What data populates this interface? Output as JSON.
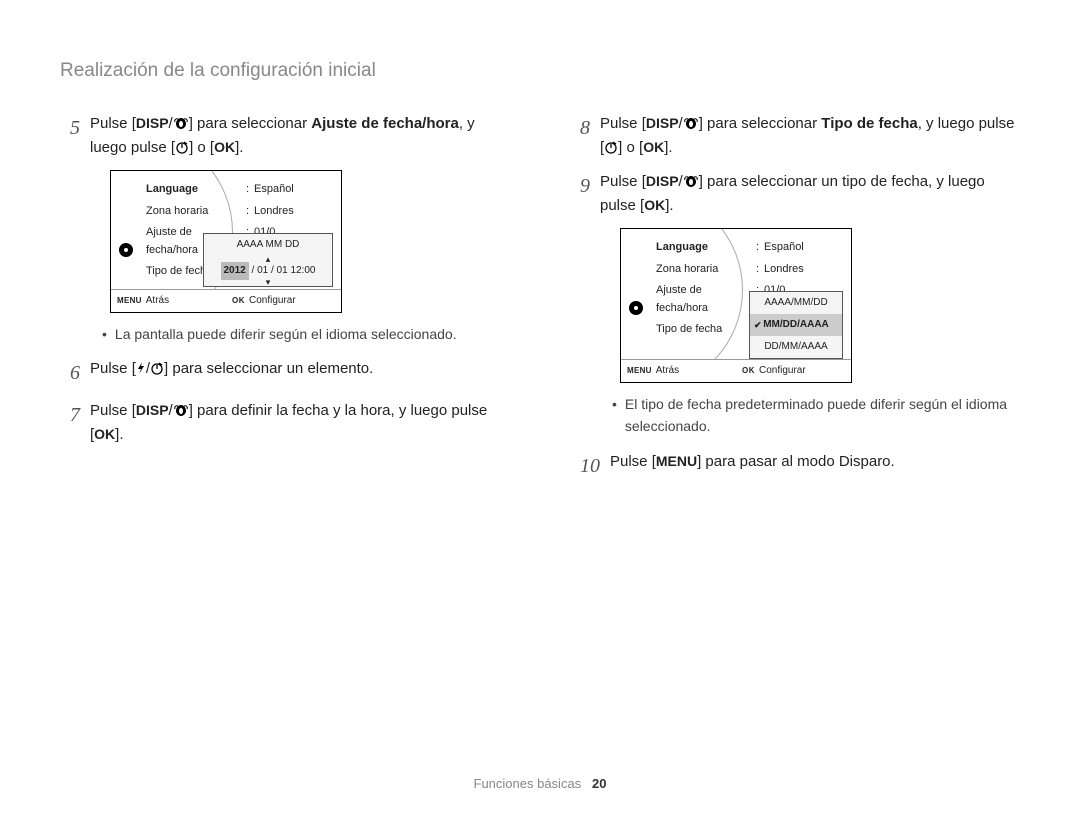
{
  "title": "Realización de la configuración inicial",
  "btn": {
    "disp": "DISP",
    "ok": "OK",
    "menu": "MENU"
  },
  "left": {
    "step5": {
      "num": "5",
      "p1a": "Pulse [",
      "p1b": "] para seleccionar ",
      "p1_bold": "Ajuste de fecha/hora",
      "p1c": ", y luego pulse [",
      "p1d": "] o [",
      "p1e": "]."
    },
    "lcd": {
      "row1_label": "Language",
      "row1_value": "Español",
      "row2_label": "Zona horaria",
      "row2_value": "Londres",
      "row3_label": "Ajuste de fecha/hora",
      "row3_value": "01/0…",
      "row4_label": "Tipo de fech",
      "popup_header": "AAAA  MM  DD",
      "popup_year": "2012",
      "popup_rest": "/ 01 / 01 12:00",
      "footer_menu": "MENU",
      "footer_back": "Atrás",
      "footer_ok": "OK",
      "footer_set": "Configurar"
    },
    "bullet": "La pantalla puede diferir según el idioma seleccionado.",
    "step6": {
      "num": "6",
      "a": "Pulse [",
      "b": "] para seleccionar un elemento."
    },
    "step7": {
      "num": "7",
      "a": "Pulse [",
      "b": "] para definir la fecha y la hora, y luego pulse [",
      "c": "]."
    }
  },
  "right": {
    "step8": {
      "num": "8",
      "a": "Pulse [",
      "b": "] para seleccionar ",
      "bold": "Tipo de fecha",
      "c": ", y luego pulse [",
      "d": "] o [",
      "e": "]."
    },
    "step9": {
      "num": "9",
      "a": "Pulse [",
      "b": "] para seleccionar un tipo de fecha, y luego pulse [",
      "c": "]."
    },
    "lcd": {
      "row1_label": "Language",
      "row1_value": "Español",
      "row2_label": "Zona horaria",
      "row2_value": "Londres",
      "row3_label": "Ajuste de fecha/hora",
      "row3_value": "01/0…",
      "row4_label": "Tipo de fecha",
      "opt1": "AAAA/MM/DD",
      "opt2": "MM/DD/AAAA",
      "opt3": "DD/MM/AAAA",
      "footer_menu": "MENU",
      "footer_back": "Atrás",
      "footer_ok": "OK",
      "footer_set": "Configurar"
    },
    "bullet": "El tipo de fecha predeterminado puede diferir según el idioma seleccionado.",
    "step10": {
      "num": "10",
      "a": "Pulse [",
      "b": "] para pasar al modo Disparo."
    }
  },
  "footer": {
    "section": "Funciones básicas",
    "page": "20"
  }
}
